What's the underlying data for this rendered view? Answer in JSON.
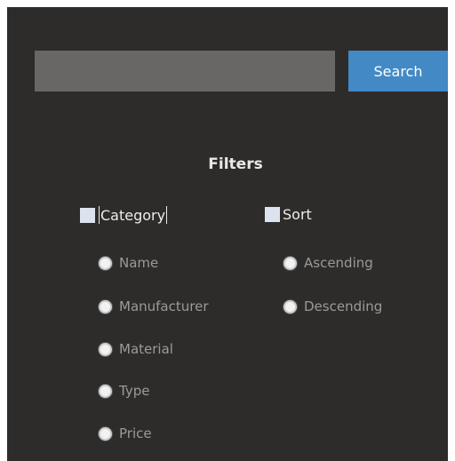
{
  "search": {
    "value": "",
    "placeholder": "",
    "button_label": "Search"
  },
  "filters": {
    "title": "Filters",
    "category": {
      "label": "Category",
      "checked": false,
      "options": [
        "Name",
        "Manufacturer",
        "Material",
        "Type",
        "Price"
      ]
    },
    "sort": {
      "label": "Sort",
      "checked": false,
      "options": [
        "Ascending",
        "Descending"
      ]
    }
  },
  "colors": {
    "panel_background": "#2e2c2b",
    "search_input": "#696766",
    "search_button": "#4289c6"
  }
}
